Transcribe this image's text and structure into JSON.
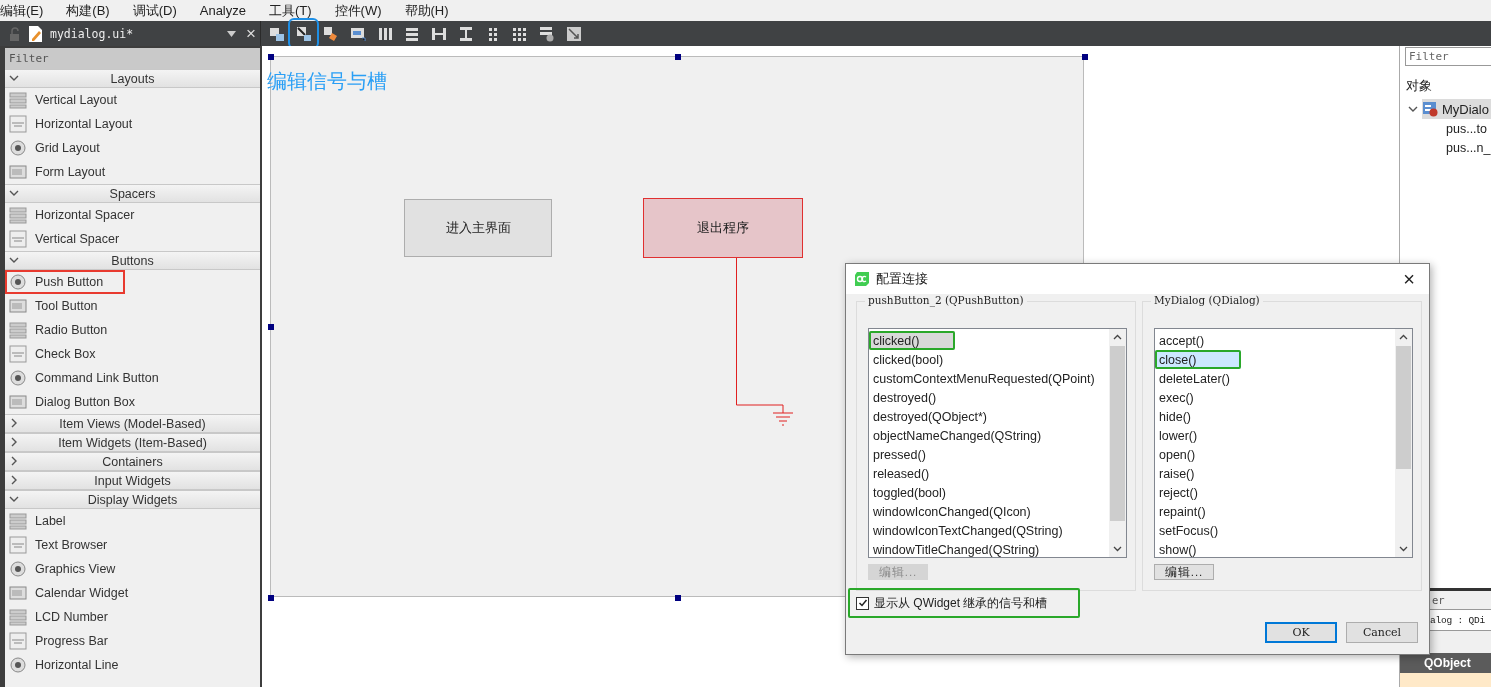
{
  "menu_bar": [
    "编辑(E)",
    "构建(B)",
    "调试(D)",
    "Analyze",
    "工具(T)",
    "控件(W)",
    "帮助(H)"
  ],
  "editor_tab": {
    "file_name": "mydialog.ui*",
    "close": "×"
  },
  "toolbar": [
    {
      "highlighted": false
    },
    {
      "highlighted": true
    },
    {
      "highlighted": false
    },
    {
      "highlighted": false
    },
    {
      "highlighted": false
    },
    {
      "highlighted": false
    },
    {
      "highlighted": false
    },
    {
      "highlighted": false
    },
    {
      "highlighted": false
    },
    {
      "highlighted": false
    },
    {
      "highlighted": false
    },
    {
      "highlighted": false
    }
  ],
  "widget_box": {
    "filter_placeholder": "Filter",
    "categories": [
      {
        "label": "Layouts",
        "expanded": true,
        "items": [
          {
            "label": "Vertical Layout",
            "highlighted": false
          },
          {
            "label": "Horizontal Layout",
            "highlighted": false
          },
          {
            "label": "Grid Layout",
            "highlighted": false
          },
          {
            "label": "Form Layout",
            "highlighted": false
          }
        ]
      },
      {
        "label": "Spacers",
        "expanded": true,
        "items": [
          {
            "label": "Horizontal Spacer",
            "highlighted": false
          },
          {
            "label": "Vertical Spacer",
            "highlighted": false
          }
        ]
      },
      {
        "label": "Buttons",
        "expanded": true,
        "items": [
          {
            "label": "Push Button",
            "highlighted": true
          },
          {
            "label": "Tool Button",
            "highlighted": false
          },
          {
            "label": "Radio Button",
            "highlighted": false
          },
          {
            "label": "Check Box",
            "highlighted": false
          },
          {
            "label": "Command Link Button",
            "highlighted": false
          },
          {
            "label": "Dialog Button Box",
            "highlighted": false
          }
        ]
      },
      {
        "label": "Item Views (Model-Based)",
        "expanded": false
      },
      {
        "label": "Item Widgets (Item-Based)",
        "expanded": false
      },
      {
        "label": "Containers",
        "expanded": false
      },
      {
        "label": "Input Widgets",
        "expanded": false
      },
      {
        "label": "Display Widgets",
        "expanded": true,
        "items": [
          {
            "label": "Label",
            "highlighted": false
          },
          {
            "label": "Text Browser",
            "highlighted": false
          },
          {
            "label": "Graphics View",
            "highlighted": false
          },
          {
            "label": "Calendar Widget",
            "highlighted": false
          },
          {
            "label": "LCD Number",
            "highlighted": false
          },
          {
            "label": "Progress Bar",
            "highlighted": false
          },
          {
            "label": "Horizontal Line",
            "highlighted": false
          }
        ]
      }
    ]
  },
  "form": {
    "title": "编辑信号与槽",
    "buttons": [
      {
        "label": "进入主界面",
        "selected": false
      },
      {
        "label": "退出程序",
        "selected": true
      }
    ]
  },
  "dialog": {
    "title": "配置连接",
    "close": "×",
    "sender": {
      "title": "pushButton_2 (QPushButton)",
      "edit": "编辑...",
      "edit_disabled": true,
      "items": [
        {
          "label": "clicked()",
          "selected": true,
          "highlighted": true
        },
        {
          "label": "clicked(bool)",
          "selected": false,
          "highlighted": false
        },
        {
          "label": "customContextMenuRequested(QPoint)",
          "selected": false,
          "highlighted": false
        },
        {
          "label": "destroyed()",
          "selected": false,
          "highlighted": false
        },
        {
          "label": "destroyed(QObject*)",
          "selected": false,
          "highlighted": false
        },
        {
          "label": "objectNameChanged(QString)",
          "selected": false,
          "highlighted": false
        },
        {
          "label": "pressed()",
          "selected": false,
          "highlighted": false
        },
        {
          "label": "released()",
          "selected": false,
          "highlighted": false
        },
        {
          "label": "toggled(bool)",
          "selected": false,
          "highlighted": false
        },
        {
          "label": "windowIconChanged(QIcon)",
          "selected": false,
          "highlighted": false
        },
        {
          "label": "windowIconTextChanged(QString)",
          "selected": false,
          "highlighted": false
        },
        {
          "label": "windowTitleChanged(QString)",
          "selected": false,
          "highlighted": false
        }
      ]
    },
    "receiver": {
      "title": "MyDialog (QDialog)",
      "edit": "编辑...",
      "edit_disabled": false,
      "items": [
        {
          "label": "accept()",
          "selected": false,
          "highlighted": false
        },
        {
          "label": "close()",
          "selected": true,
          "highlighted": true
        },
        {
          "label": "deleteLater()",
          "selected": false,
          "highlighted": false
        },
        {
          "label": "exec()",
          "selected": false,
          "highlighted": false
        },
        {
          "label": "hide()",
          "selected": false,
          "highlighted": false
        },
        {
          "label": "lower()",
          "selected": false,
          "highlighted": false
        },
        {
          "label": "open()",
          "selected": false,
          "highlighted": false
        },
        {
          "label": "raise()",
          "selected": false,
          "highlighted": false
        },
        {
          "label": "reject()",
          "selected": false,
          "highlighted": false
        },
        {
          "label": "repaint()",
          "selected": false,
          "highlighted": false
        },
        {
          "label": "setFocus()",
          "selected": false,
          "highlighted": false
        },
        {
          "label": "show()",
          "selected": false,
          "highlighted": false
        }
      ]
    },
    "inherited": {
      "label": "显示从 QWidget 继承的信号和槽",
      "checked": true,
      "highlighted": true
    },
    "buttons": [
      "OK",
      "Cancel"
    ]
  },
  "object_inspector": {
    "filter_placeholder": "Filter",
    "header": "对象",
    "tree": [
      {
        "label": "MyDialo",
        "expanded": true,
        "selected": true,
        "children": [
          {
            "label": "pus...to",
            "selected": false
          },
          {
            "label": "pus...n_",
            "selected": false
          }
        ]
      }
    ]
  },
  "property_editor": {
    "title": "er",
    "object": "alog : QDi",
    "section": "QObject"
  }
}
